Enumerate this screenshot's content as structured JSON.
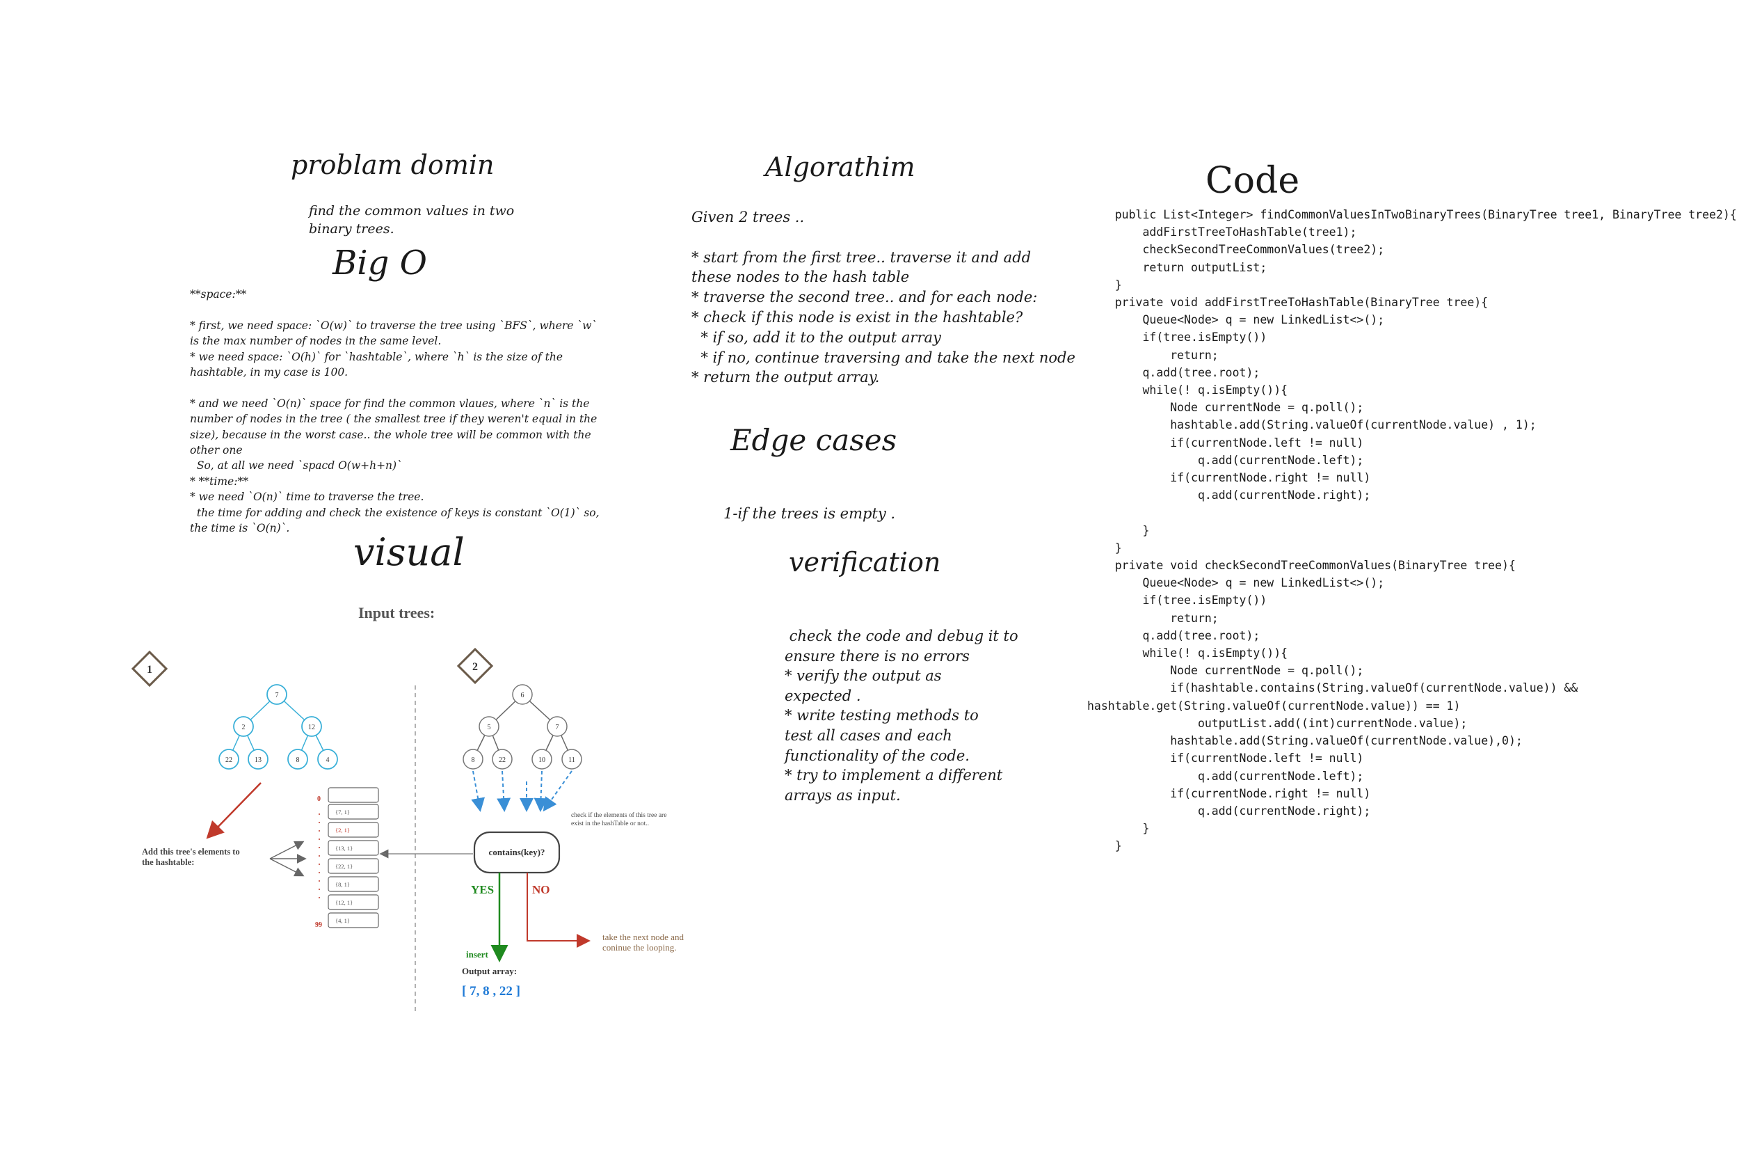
{
  "problem": {
    "title": "problam domin",
    "text": "find the common values in two\nbinary trees."
  },
  "bigo": {
    "title": "Big O",
    "text": "**space:**\n\n* first, we need space: `O(w)` to traverse the tree using `BFS`, where `w`\nis the max number of nodes in the same level.\n* we need space: `O(h)` for `hashtable`, where `h` is the size of the\nhashtable, in my case is 100.\n\n* and we need `O(n)` space for find the common vlaues, where `n` is the\nnumber of nodes in the tree ( the smallest tree if they weren't equal in the\nsize), because in the worst case.. the whole tree will be common with the\nother one\n  So, at all we need `spacd O(w+h+n)`\n* **time:**\n* we need `O(n)` time to traverse the tree.\n  the time for adding and check the existence of keys is constant `O(1)` so,\nthe time is `O(n)`."
  },
  "visual": {
    "title": "visual",
    "input_label": "Input trees:",
    "badge1": "1",
    "badge2": "2",
    "tree1": [
      "7",
      "2",
      "12",
      "22",
      "13",
      "8",
      "4"
    ],
    "tree2": [
      "6",
      "5",
      "7",
      "8",
      "22",
      "10",
      "11"
    ],
    "add_label_line1": "Add this tree's elements to",
    "add_label_line2": "the hashtable:",
    "hash_index_start": "0",
    "hash_index_end": "99",
    "hash_rows": [
      "{7, 1}",
      "{2, 1}",
      "{13, 1}",
      "{22, 1}",
      "{8, 1}",
      "{12, 1}",
      "{4, 1}"
    ],
    "check_note_line1": "check if the elements of this tree are",
    "check_note_line2": "exist in the hashTable or not..",
    "contains": "contains(key)?",
    "yes": "YES",
    "no": "NO",
    "insert": "insert",
    "next_line1": "take the next node and",
    "next_line2": "coninue the looping.",
    "output_label": "Output array:",
    "output_value": "[ 7, 8 , 22 ]",
    "colors": {
      "tree1": "#3ab0d8",
      "tree2": "#777777",
      "red": "#c0392b",
      "green": "#1f8a1f",
      "blue": "#1f7ad6",
      "arrow_blue": "#3a8fd6"
    }
  },
  "algorithm": {
    "title": "Algorathim",
    "text": "Given 2 trees ..\n\n* start from the first tree.. traverse it and add\nthese nodes to the hash table\n* traverse the second tree.. and for each node:\n* check if this node is exist in the hashtable?\n  * if so, add it to the output array\n  * if no, continue traversing and take the next node\n* return the output array."
  },
  "edge": {
    "title": "Edge cases",
    "text": "1-if the trees is empty ."
  },
  "verification": {
    "title": "verification",
    "text": " check the code and debug it to\nensure there is no errors\n* verify the output as\nexpected .\n* write testing methods to\ntest all cases and each\nfunctionality of the code.\n* try to implement a different\narrays as input."
  },
  "code": {
    "title": "Code",
    "text": "    public List<Integer> findCommonValuesInTwoBinaryTrees(BinaryTree tree1, BinaryTree tree2){\n        addFirstTreeToHashTable(tree1);\n        checkSecondTreeCommonValues(tree2);\n        return outputList;\n    }\n    private void addFirstTreeToHashTable(BinaryTree tree){\n        Queue<Node> q = new LinkedList<>();\n        if(tree.isEmpty())\n            return;\n        q.add(tree.root);\n        while(! q.isEmpty()){\n            Node currentNode = q.poll();\n            hashtable.add(String.valueOf(currentNode.value) , 1);\n            if(currentNode.left != null)\n                q.add(currentNode.left);\n            if(currentNode.right != null)\n                q.add(currentNode.right);\n\n        }\n    }\n    private void checkSecondTreeCommonValues(BinaryTree tree){\n        Queue<Node> q = new LinkedList<>();\n        if(tree.isEmpty())\n            return;\n        q.add(tree.root);\n        while(! q.isEmpty()){\n            Node currentNode = q.poll();\n            if(hashtable.contains(String.valueOf(currentNode.value)) &&\nhashtable.get(String.valueOf(currentNode.value)) == 1)\n                outputList.add((int)currentNode.value);\n            hashtable.add(String.valueOf(currentNode.value),0);\n            if(currentNode.left != null)\n                q.add(currentNode.left);\n            if(currentNode.right != null)\n                q.add(currentNode.right);\n        }\n    }"
  }
}
